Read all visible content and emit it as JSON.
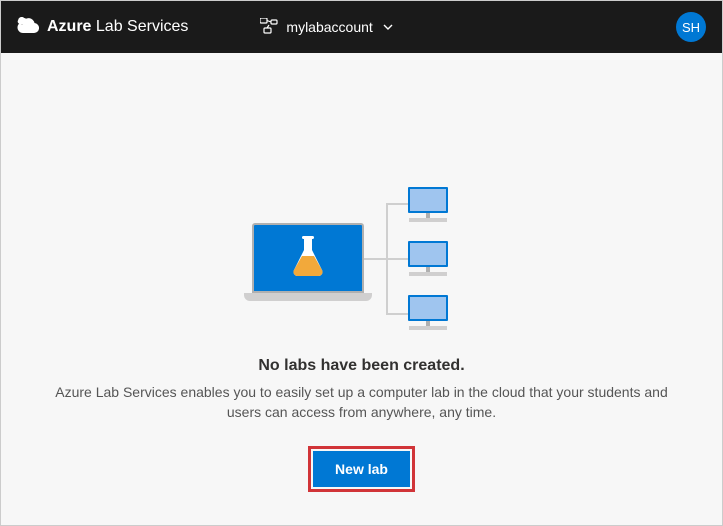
{
  "header": {
    "brand_bold": "Azure",
    "brand_light": "Lab Services",
    "account_name": "mylabaccount",
    "avatar_initials": "SH"
  },
  "empty_state": {
    "title": "No labs have been created.",
    "description": "Azure Lab Services enables you to easily set up a computer lab in the cloud that your students and users can access from anywhere, any time.",
    "new_lab_label": "New lab"
  },
  "icons": {
    "azure_cloud": "azure-cloud-icon",
    "resource_group": "resource-group-icon",
    "flask": "flask-icon"
  }
}
